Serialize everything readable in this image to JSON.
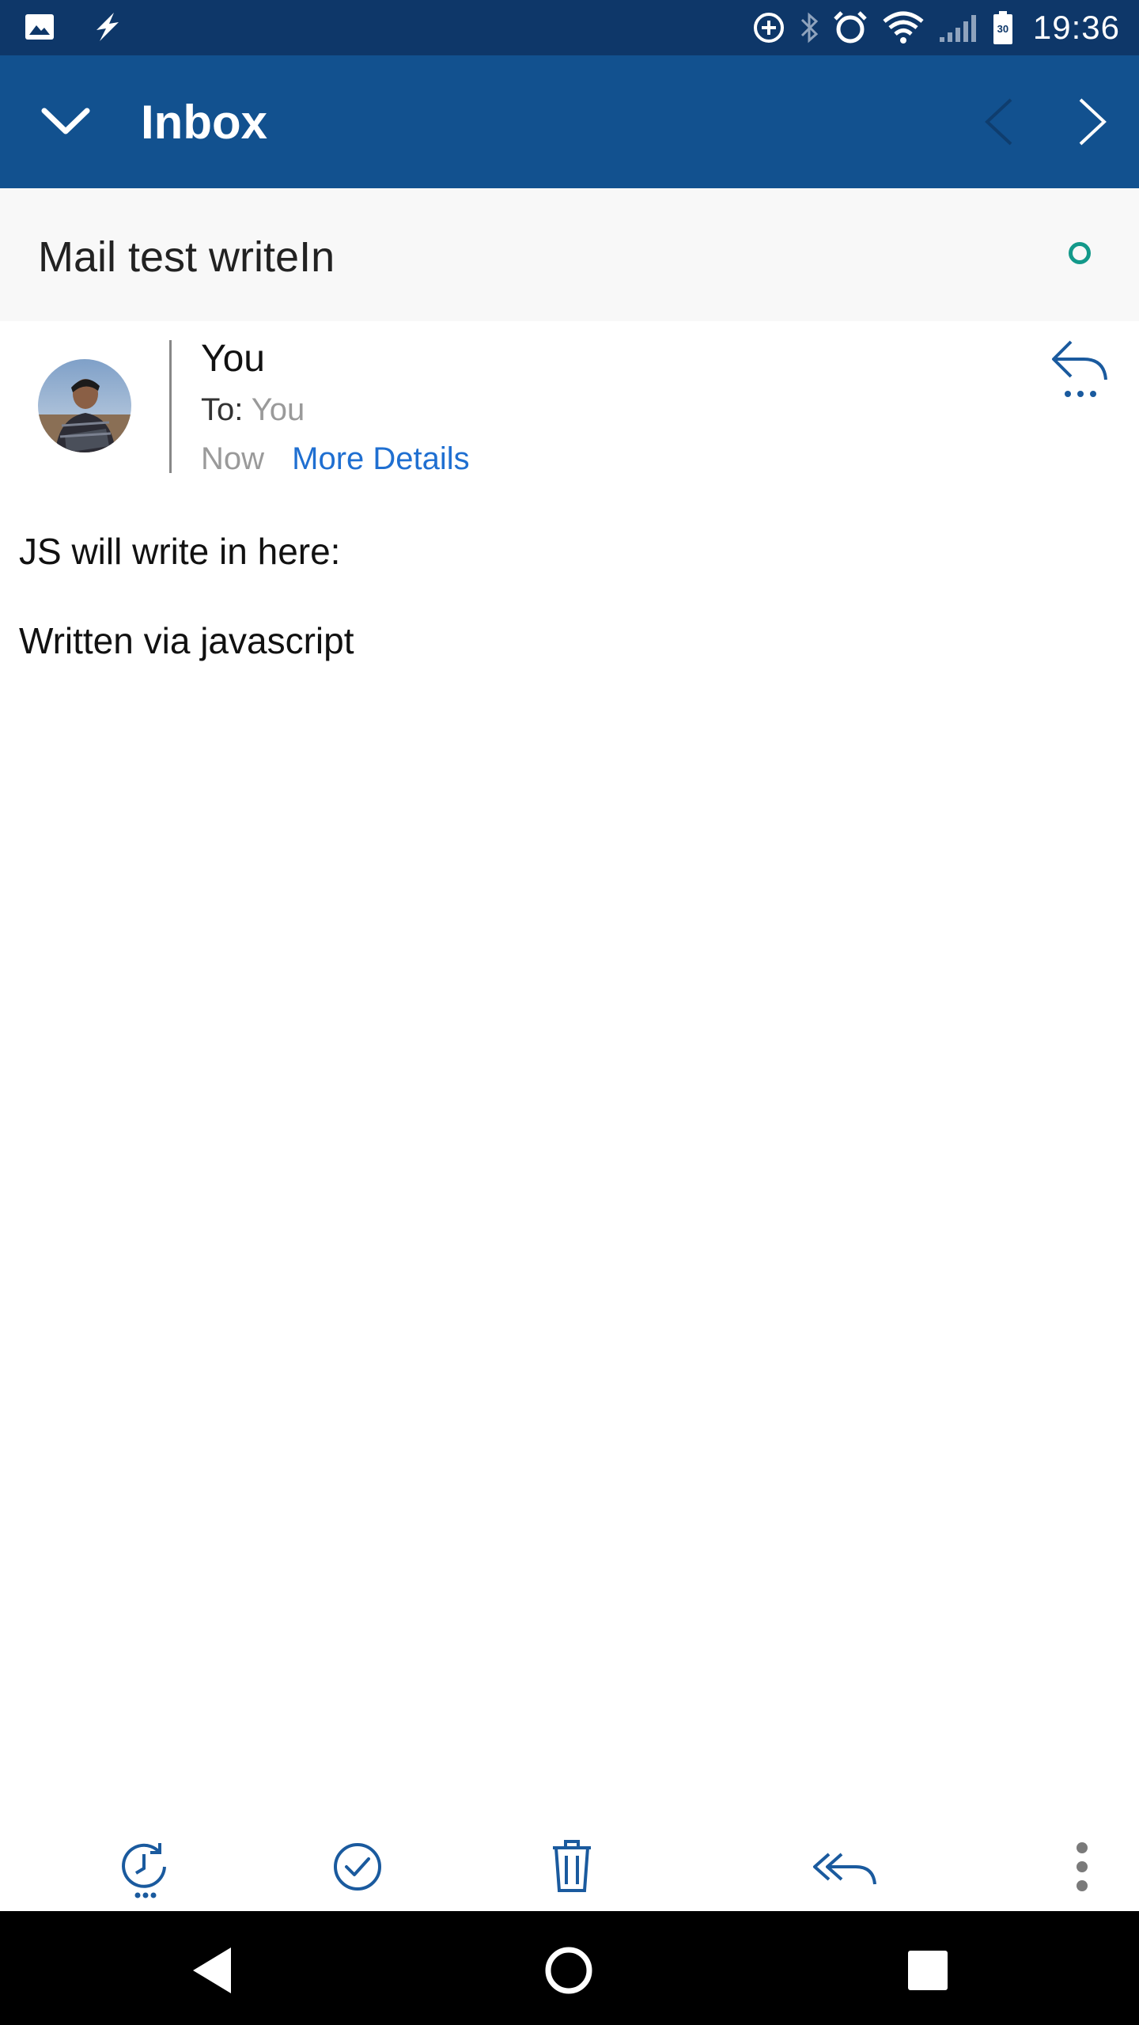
{
  "status_bar": {
    "time": "19:36",
    "battery_level": "30",
    "icons": [
      "image-icon",
      "flash-icon",
      "data-saver-icon",
      "bluetooth-icon",
      "alarm-icon",
      "wifi-icon",
      "signal-icon",
      "battery-icon"
    ]
  },
  "app_bar": {
    "title": "Inbox",
    "icons": [
      "chevron-down-icon",
      "chevron-left-icon",
      "chevron-right-icon"
    ]
  },
  "message": {
    "subject": "Mail test writeIn",
    "sender": "You",
    "to_label": "To:",
    "to_value": "You",
    "time": "Now",
    "more_details": "More Details",
    "body": [
      "JS will write in here:",
      "Written via javascript"
    ]
  },
  "toolbar": {
    "icons": [
      "snooze-icon",
      "mark-done-icon",
      "delete-icon",
      "reply-all-icon",
      "more-options-icon"
    ]
  },
  "nav_bar": {
    "icons": [
      "back-icon",
      "home-icon",
      "recents-icon"
    ]
  },
  "colors": {
    "status_bar": "#0e3769",
    "app_bar": "#12518f",
    "accent_link": "#1f6fd1",
    "unread_dot": "#13998a",
    "icon_blue": "#1a5a9e"
  }
}
